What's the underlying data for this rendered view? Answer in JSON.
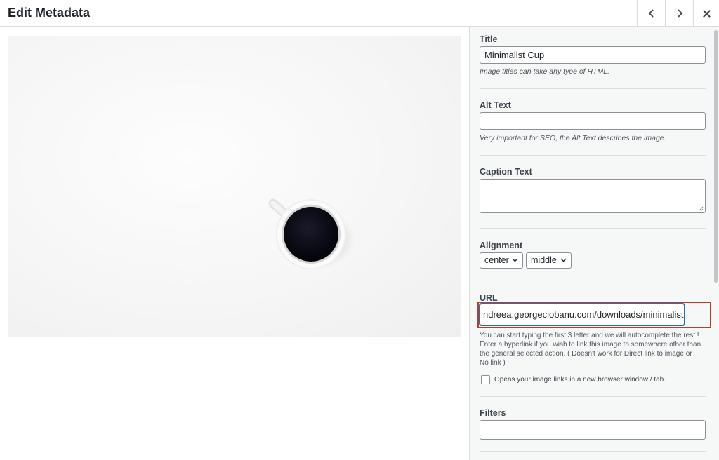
{
  "header": {
    "title": "Edit Metadata"
  },
  "image": {
    "alt": "Minimalist Cup"
  },
  "sidebar": {
    "title": {
      "label": "Title",
      "value": "Minimalist Cup",
      "hint": "Image titles can take any type of HTML."
    },
    "alt_text": {
      "label": "Alt Text",
      "value": "",
      "hint": "Very important for SEO, the Alt Text describes the image."
    },
    "caption": {
      "label": "Caption Text",
      "value": ""
    },
    "alignment": {
      "label": "Alignment",
      "horizontal": "center",
      "vertical": "middle"
    },
    "url": {
      "label": "URL",
      "value": "ndreea.georgeciobanu.com/downloads/minimalist-cup",
      "hint": "You can start typing the first 3 letter and we will autocomplete the rest ! Enter a hyperlink if you wish to link this image to somewhere other than the general selected action. ( Doesn't work for Direct link to image or No link )"
    },
    "new_window": {
      "label": "Opens your image links in a new browser window / tab.",
      "checked": false
    },
    "filters": {
      "label": "Filters",
      "value": ""
    }
  }
}
